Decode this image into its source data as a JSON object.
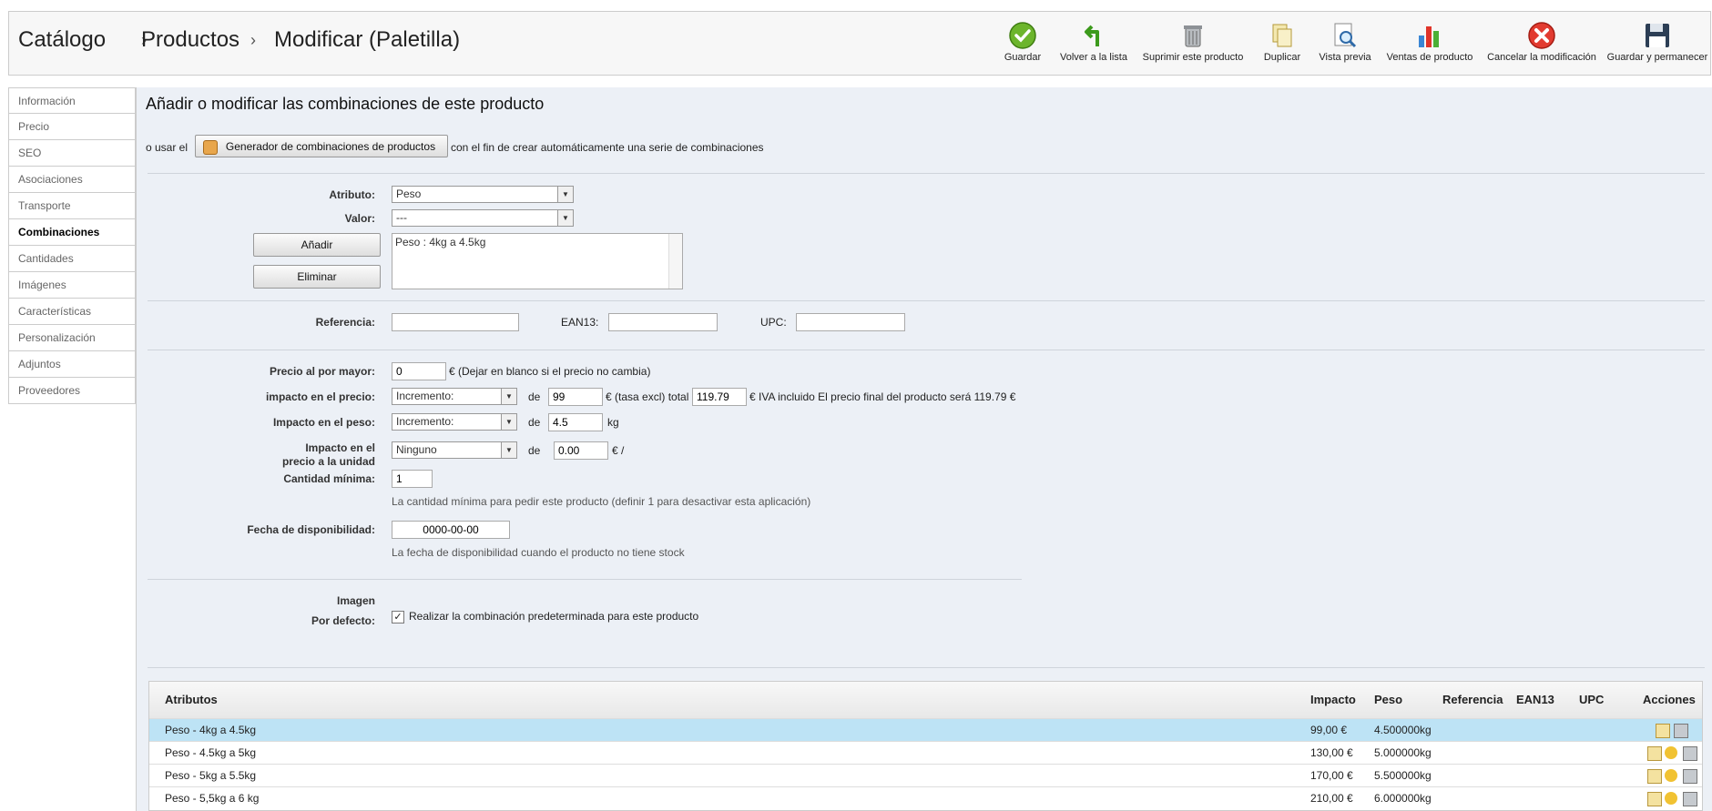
{
  "breadcrumb": [
    "Catálogo",
    "Productos",
    "Modificar (Paletilla)"
  ],
  "toolbar": [
    {
      "label": "Guardar",
      "icon": "save-check-icon"
    },
    {
      "label": "Volver a la lista",
      "icon": "back-arrow-icon"
    },
    {
      "label": "Suprimir este producto",
      "icon": "trash-icon"
    },
    {
      "label": "Duplicar",
      "icon": "duplicate-icon"
    },
    {
      "label": "Vista previa",
      "icon": "preview-icon"
    },
    {
      "label": "Ventas de producto",
      "icon": "sales-chart-icon"
    },
    {
      "label": "Cancelar la modificación",
      "icon": "cancel-icon"
    },
    {
      "label": "Guardar y permanecer",
      "icon": "floppy-icon"
    }
  ],
  "sidebar": {
    "items": [
      "Información",
      "Precio",
      "SEO",
      "Asociaciones",
      "Transporte",
      "Combinaciones",
      "Cantidades",
      "Imágenes",
      "Características",
      "Personalización",
      "Adjuntos",
      "Proveedores"
    ],
    "active": "Combinaciones"
  },
  "main": {
    "title": "Añadir o modificar las combinaciones de este producto",
    "generator_prefix": "o usar el",
    "generator_button": "Generador de combinaciones de productos",
    "generator_suffix": "con el fin de crear automáticamente una serie de combinaciones",
    "attribute_label": "Atributo:",
    "attribute_value": "Peso",
    "value_label": "Valor:",
    "value_value": "---",
    "add_button": "Añadir",
    "delete_button": "Eliminar",
    "combination_list": "Peso : 4kg a 4.5kg",
    "reference_label": "Referencia:",
    "reference_value": "",
    "ean13_label": "EAN13:",
    "ean13_value": "",
    "upc_label": "UPC:",
    "upc_value": "",
    "wholesale_label": "Precio al por mayor:",
    "wholesale_value": "0",
    "wholesale_hint": "€ (Dejar en blanco si el precio no cambia)",
    "price_impact_label": "impacto en el precio:",
    "price_impact_select": "Incremento:",
    "de": "de",
    "price_impact_value": "99",
    "price_tax_text": "€ (tasa excl) total",
    "price_total_value": "119.79",
    "price_final_text": "€ IVA incluido El precio final del producto será 119.79 €",
    "weight_impact_label": "Impacto en el peso:",
    "weight_impact_select": "Incremento:",
    "weight_impact_value": "4.5",
    "weight_unit": "kg",
    "unit_impact_label_1": "Impacto en el",
    "unit_impact_label_2": "precio a la unidad",
    "unit_impact_select": "Ninguno",
    "unit_impact_value": "0.00",
    "unit_impact_suffix": "€ /",
    "min_qty_label": "Cantidad mínima:",
    "min_qty_value": "1",
    "min_qty_hint": "La cantidad mínima para pedir este producto (definir 1 para desactivar esta aplicación)",
    "availability_label": "Fecha de disponibilidad:",
    "availability_value": "0000-00-00",
    "availability_hint": "La fecha de disponibilidad cuando el producto no tiene stock",
    "image_label": "Imagen",
    "default_label": "Por defecto:",
    "default_checkbox_text": "Realizar la combinación predeterminada para este producto",
    "default_checked": true
  },
  "table": {
    "headers": [
      "Atributos",
      "Impacto",
      "Peso",
      "Referencia",
      "EAN13",
      "UPC",
      "Acciones"
    ],
    "rows": [
      {
        "attr": "Peso - 4kg a 4.5kg",
        "impact": "99,00 €",
        "weight": "4.500000kg",
        "selected": true
      },
      {
        "attr": "Peso - 4.5kg a 5kg",
        "impact": "130,00 €",
        "weight": "5.000000kg",
        "selected": false
      },
      {
        "attr": "Peso - 5kg a 5.5kg",
        "impact": "170,00 €",
        "weight": "5.500000kg",
        "selected": false
      },
      {
        "attr": "Peso - 5,5kg a 6 kg",
        "impact": "210,00 €",
        "weight": "6.000000kg",
        "selected": false
      }
    ]
  }
}
